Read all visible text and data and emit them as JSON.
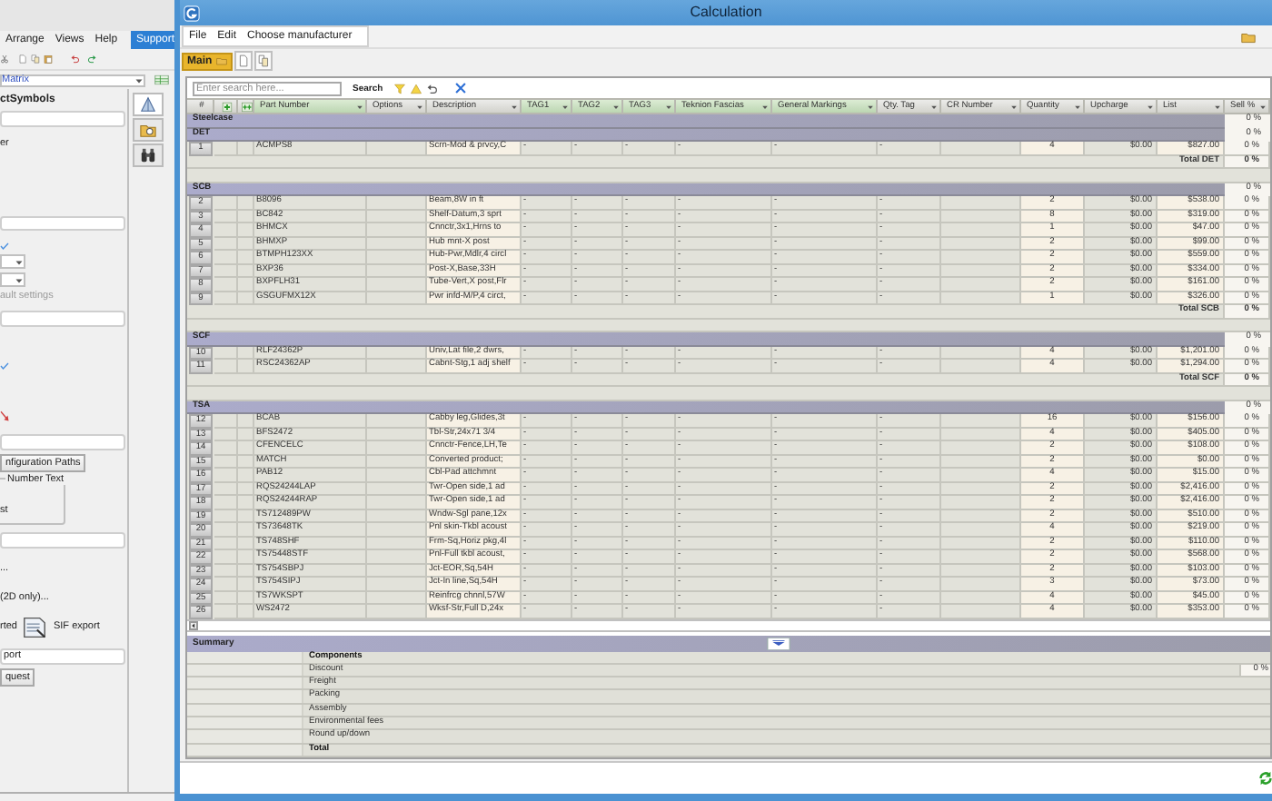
{
  "left_app": {
    "menu": [
      "Arrange",
      "Views",
      "Help"
    ],
    "support_tab": "Support",
    "view_select": {
      "value": "Matrix"
    },
    "side_tabs": [
      {
        "selected": true
      },
      {
        "selected": false
      },
      {
        "selected": false
      }
    ],
    "items": [
      {
        "kind": "heading",
        "text": "ctSymbols"
      },
      {
        "kind": "field"
      },
      {
        "kind": "text",
        "text": "er",
        "disabled": false
      },
      {
        "kind": "field"
      },
      {
        "kind": "dropdown"
      },
      {
        "kind": "dropdown"
      },
      {
        "kind": "text",
        "text": "ault settings",
        "disabled": true
      },
      {
        "kind": "field"
      },
      {
        "kind": "field"
      },
      {
        "kind": "button",
        "text": "nfiguration Paths"
      },
      {
        "kind": "group",
        "title": "Number Text",
        "text": "st"
      },
      {
        "kind": "field"
      },
      {
        "kind": "text",
        "text": "...",
        "disabled": false
      },
      {
        "kind": "text",
        "text": "(2D only)...",
        "disabled": false
      },
      {
        "kind": "export",
        "texts": [
          "rted",
          "SIF export"
        ]
      },
      {
        "kind": "field",
        "value": "port"
      },
      {
        "kind": "button",
        "text": "quest"
      }
    ]
  },
  "window": {
    "title": "Calculation",
    "menu": [
      "File",
      "Edit",
      "Choose manufacturer"
    ],
    "toolbar_tabs": [
      {
        "label": "Main",
        "selected": true
      }
    ],
    "search": {
      "placeholder": "Enter search here...",
      "button": "Search"
    }
  },
  "table": {
    "columns": [
      {
        "kind": "text",
        "label": "#",
        "highlighted": false
      },
      {
        "kind": "icon",
        "highlighted": false
      },
      {
        "kind": "icon",
        "highlighted": false
      },
      {
        "kind": "text",
        "label": "Part Number",
        "highlighted": true
      },
      {
        "kind": "text",
        "label": "Options",
        "highlighted": false
      },
      {
        "kind": "text",
        "label": "Description",
        "highlighted": false
      },
      {
        "kind": "text",
        "label": "TAG1",
        "highlighted": true
      },
      {
        "kind": "text",
        "label": "TAG2",
        "highlighted": true
      },
      {
        "kind": "text",
        "label": "TAG3",
        "highlighted": true
      },
      {
        "kind": "text",
        "label": "Teknion Fascias",
        "highlighted": true
      },
      {
        "kind": "text",
        "label": "General Markings",
        "highlighted": true
      },
      {
        "kind": "text",
        "label": "Qty. Tag",
        "highlighted": false
      },
      {
        "kind": "text",
        "label": "CR Number",
        "highlighted": false
      },
      {
        "kind": "text",
        "label": "Quantity",
        "highlighted": false
      },
      {
        "kind": "text",
        "label": "Upcharge",
        "highlighted": false
      },
      {
        "kind": "text",
        "label": "List",
        "highlighted": false
      },
      {
        "kind": "text",
        "label": "Sell %",
        "highlighted": false
      }
    ],
    "manufacturers": [
      {
        "name": "Steelcase",
        "sell": "0 %",
        "groups": [
          {
            "name": "DET",
            "sell": "0 %",
            "items": [
              {
                "number": "1",
                "part": "ACMPS8",
                "description": "Scrn-Mod & prvcy,C",
                "tags": [
                  "-",
                  "-",
                  "-",
                  "-",
                  "-",
                  "-"
                ],
                "quantity": "4",
                "upcharge": "$0.00",
                "list": "$827.00",
                "sell": "0 %"
              }
            ],
            "total": {
              "label": "Total DET",
              "sell": "0 %"
            }
          },
          {
            "name": "SCB",
            "sell": "0 %",
            "items": [
              {
                "number": "2",
                "part": "B8096",
                "description": "Beam,8W in ft",
                "tags": [
                  "-",
                  "-",
                  "-",
                  "-",
                  "-",
                  "-"
                ],
                "quantity": "2",
                "upcharge": "$0.00",
                "list": "$538.00",
                "sell": "0 %"
              },
              {
                "number": "3",
                "part": "BC842",
                "description": "Shelf-Datum,3 sprt",
                "tags": [
                  "-",
                  "-",
                  "-",
                  "-",
                  "-",
                  "-"
                ],
                "quantity": "8",
                "upcharge": "$0.00",
                "list": "$319.00",
                "sell": "0 %"
              },
              {
                "number": "4",
                "part": "BHMCX",
                "description": "Cnnctr,3x1,Hrns to",
                "tags": [
                  "-",
                  "-",
                  "-",
                  "-",
                  "-",
                  "-"
                ],
                "quantity": "1",
                "upcharge": "$0.00",
                "list": "$47.00",
                "sell": "0 %"
              },
              {
                "number": "5",
                "part": "BHMXP",
                "description": "Hub mnt-X post",
                "tags": [
                  "-",
                  "-",
                  "-",
                  "-",
                  "-",
                  "-"
                ],
                "quantity": "2",
                "upcharge": "$0.00",
                "list": "$99.00",
                "sell": "0 %"
              },
              {
                "number": "6",
                "part": "BTMPH123XX",
                "description": "Hub-Pwr,Mdlr,4 circl",
                "tags": [
                  "-",
                  "-",
                  "-",
                  "-",
                  "-",
                  "-"
                ],
                "quantity": "2",
                "upcharge": "$0.00",
                "list": "$559.00",
                "sell": "0 %"
              },
              {
                "number": "7",
                "part": "BXP36",
                "description": "Post-X,Base,33H",
                "tags": [
                  "-",
                  "-",
                  "-",
                  "-",
                  "-",
                  "-"
                ],
                "quantity": "2",
                "upcharge": "$0.00",
                "list": "$334.00",
                "sell": "0 %"
              },
              {
                "number": "8",
                "part": "BXPFLH31",
                "description": "Tube-Vert,X post,Flr",
                "tags": [
                  "-",
                  "-",
                  "-",
                  "-",
                  "-",
                  "-"
                ],
                "quantity": "2",
                "upcharge": "$0.00",
                "list": "$161.00",
                "sell": "0 %"
              },
              {
                "number": "9",
                "part": "GSGUFMX12X",
                "description": "Pwr infd-M/P,4 circt,",
                "tags": [
                  "-",
                  "-",
                  "-",
                  "-",
                  "-",
                  "-"
                ],
                "quantity": "1",
                "upcharge": "$0.00",
                "list": "$326.00",
                "sell": "0 %"
              }
            ],
            "total": {
              "label": "Total SCB",
              "sell": "0 %"
            }
          },
          {
            "name": "SCF",
            "sell": "0 %",
            "items": [
              {
                "number": "10",
                "part": "RLF24362P",
                "description": "Univ,Lat file,2 dwrs,",
                "tags": [
                  "-",
                  "-",
                  "-",
                  "-",
                  "-",
                  "-"
                ],
                "quantity": "4",
                "upcharge": "$0.00",
                "list": "$1,201.00",
                "sell": "0 %"
              },
              {
                "number": "11",
                "part": "RSC24362AP",
                "description": "Cabnt-Stg,1 adj shelf",
                "tags": [
                  "-",
                  "-",
                  "-",
                  "-",
                  "-",
                  "-"
                ],
                "quantity": "4",
                "upcharge": "$0.00",
                "list": "$1,294.00",
                "sell": "0 %"
              }
            ],
            "total": {
              "label": "Total SCF",
              "sell": "0 %"
            }
          },
          {
            "name": "TSA",
            "sell": "0 %",
            "items": [
              {
                "number": "12",
                "part": "BCAB",
                "description": "Cabby leg,Glides,3t",
                "tags": [
                  "-",
                  "-",
                  "-",
                  "-",
                  "-",
                  "-"
                ],
                "quantity": "16",
                "upcharge": "$0.00",
                "list": "$156.00",
                "sell": "0 %"
              },
              {
                "number": "13",
                "part": "BFS2472",
                "description": "Tbl-Str,24x71 3/4",
                "tags": [
                  "-",
                  "-",
                  "-",
                  "-",
                  "-",
                  "-"
                ],
                "quantity": "4",
                "upcharge": "$0.00",
                "list": "$405.00",
                "sell": "0 %"
              },
              {
                "number": "14",
                "part": "CFENCELC",
                "description": "Cnnctr-Fence,LH,Te",
                "tags": [
                  "-",
                  "-",
                  "-",
                  "-",
                  "-",
                  "-"
                ],
                "quantity": "2",
                "upcharge": "$0.00",
                "list": "$108.00",
                "sell": "0 %"
              },
              {
                "number": "15",
                "part": "MATCH",
                "description": "Converted product;",
                "tags": [
                  "-",
                  "-",
                  "-",
                  "-",
                  "-",
                  "-"
                ],
                "quantity": "2",
                "upcharge": "$0.00",
                "list": "$0.00",
                "sell": "0 %"
              },
              {
                "number": "16",
                "part": "PAB12",
                "description": "Cbl-Pad attchmnt",
                "tags": [
                  "-",
                  "-",
                  "-",
                  "-",
                  "-",
                  "-"
                ],
                "quantity": "4",
                "upcharge": "$0.00",
                "list": "$15.00",
                "sell": "0 %"
              },
              {
                "number": "17",
                "part": "RQS24244LAP",
                "description": "Twr-Open side,1 ad",
                "tags": [
                  "-",
                  "-",
                  "-",
                  "-",
                  "-",
                  "-"
                ],
                "quantity": "2",
                "upcharge": "$0.00",
                "list": "$2,416.00",
                "sell": "0 %"
              },
              {
                "number": "18",
                "part": "RQS24244RAP",
                "description": "Twr-Open side,1 ad",
                "tags": [
                  "-",
                  "-",
                  "-",
                  "-",
                  "-",
                  "-"
                ],
                "quantity": "2",
                "upcharge": "$0.00",
                "list": "$2,416.00",
                "sell": "0 %"
              },
              {
                "number": "19",
                "part": "TS712489PW",
                "description": "Wndw-Sgl pane,12x",
                "tags": [
                  "-",
                  "-",
                  "-",
                  "-",
                  "-",
                  "-"
                ],
                "quantity": "2",
                "upcharge": "$0.00",
                "list": "$510.00",
                "sell": "0 %"
              },
              {
                "number": "20",
                "part": "TS73648TK",
                "description": "Pnl skin-Tkbl acoust",
                "tags": [
                  "-",
                  "-",
                  "-",
                  "-",
                  "-",
                  "-"
                ],
                "quantity": "4",
                "upcharge": "$0.00",
                "list": "$219.00",
                "sell": "0 %"
              },
              {
                "number": "21",
                "part": "TS748SHF",
                "description": "Frm-Sq,Horiz pkg,4l",
                "tags": [
                  "-",
                  "-",
                  "-",
                  "-",
                  "-",
                  "-"
                ],
                "quantity": "2",
                "upcharge": "$0.00",
                "list": "$110.00",
                "sell": "0 %"
              },
              {
                "number": "22",
                "part": "TS75448STF",
                "description": "Pnl-Full tkbl acoust,",
                "tags": [
                  "-",
                  "-",
                  "-",
                  "-",
                  "-",
                  "-"
                ],
                "quantity": "2",
                "upcharge": "$0.00",
                "list": "$568.00",
                "sell": "0 %"
              },
              {
                "number": "23",
                "part": "TS754SBPJ",
                "description": "Jct-EOR,Sq,54H",
                "tags": [
                  "-",
                  "-",
                  "-",
                  "-",
                  "-",
                  "-"
                ],
                "quantity": "2",
                "upcharge": "$0.00",
                "list": "$103.00",
                "sell": "0 %"
              },
              {
                "number": "24",
                "part": "TS754SIPJ",
                "description": "Jct-In line,Sq,54H",
                "tags": [
                  "-",
                  "-",
                  "-",
                  "-",
                  "-",
                  "-"
                ],
                "quantity": "3",
                "upcharge": "$0.00",
                "list": "$73.00",
                "sell": "0 %"
              },
              {
                "number": "25",
                "part": "TS7WKSPT",
                "description": "Reinfrcg chnnl,57W",
                "tags": [
                  "-",
                  "-",
                  "-",
                  "-",
                  "-",
                  "-"
                ],
                "quantity": "4",
                "upcharge": "$0.00",
                "list": "$45.00",
                "sell": "0 %"
              },
              {
                "number": "26",
                "part": "WS2472",
                "description": "Wksf-Str,Full D,24x",
                "tags": [
                  "-",
                  "-",
                  "-",
                  "-",
                  "-",
                  "-"
                ],
                "quantity": "4",
                "upcharge": "$0.00",
                "list": "$353.00",
                "sell": "0 %"
              }
            ]
          }
        ]
      }
    ]
  },
  "summary": {
    "title": "Summary",
    "rows": [
      {
        "kind": "heading",
        "label": "Components"
      },
      {
        "kind": "input",
        "label": "Discount",
        "value": "0 %"
      },
      {
        "kind": "row",
        "label": "Freight"
      },
      {
        "kind": "row",
        "label": "Packing"
      },
      {
        "kind": "row",
        "label": "Assembly"
      },
      {
        "kind": "row",
        "label": "Environmental fees"
      },
      {
        "kind": "row",
        "label": "Round up/down"
      },
      {
        "kind": "heading",
        "label": "Total"
      }
    ]
  }
}
